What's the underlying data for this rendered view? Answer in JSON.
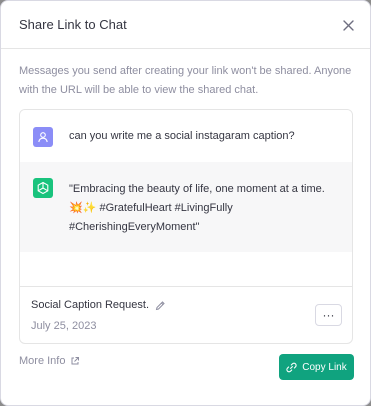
{
  "modal": {
    "title": "Share Link to Chat",
    "description": "Messages you send after creating your link won't be shared. Anyone with the URL will be able to view the shared chat."
  },
  "preview": {
    "user_message": "can you write me a social instagaram caption?",
    "assistant_message": "\"Embracing the beauty of life, one moment at a time. 💥✨ #GratefulHeart #LivingFully #CherishingEveryMoment\"",
    "chat_title": "Social Caption Request.",
    "chat_date": "July 25, 2023",
    "more_button_label": "···"
  },
  "footer": {
    "more_info_label": "More Info",
    "copy_link_label": "Copy Link"
  },
  "colors": {
    "accent": "#10a37f",
    "user_avatar": "#8b8df7",
    "assistant_avatar": "#19c37d"
  },
  "icons": {
    "close": "close-icon",
    "user_avatar": "user-icon",
    "assistant_avatar": "openai-logo-icon",
    "edit": "pencil-icon",
    "external_link": "external-link-icon",
    "copy_link": "link-icon"
  }
}
